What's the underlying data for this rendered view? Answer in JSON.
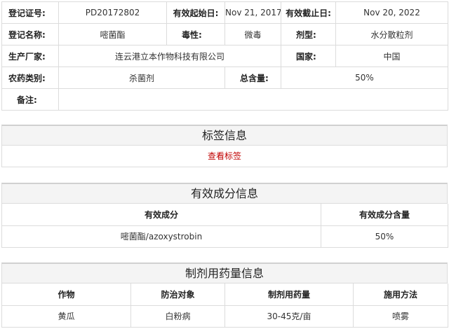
{
  "registration": {
    "reg_no_label": "登记证号:",
    "reg_no": "PD20172802",
    "valid_start_label": "有效起始日:",
    "valid_start": "Nov 21, 2017",
    "valid_end_label": "有效截止日:",
    "valid_end": "Nov 20, 2022",
    "name_label": "登记名称:",
    "name": "嘧菌酯",
    "toxicity_label": "毒性:",
    "toxicity": "微毒",
    "form_label": "剂型:",
    "form": "水分散粒剂",
    "manufacturer_label": "生产厂家:",
    "manufacturer": "连云港立本作物科技有限公司",
    "country_label": "国家:",
    "country": "中国",
    "category_label": "农药类别:",
    "category": "杀菌剂",
    "total_label": "总含量:",
    "total": "50%",
    "notes_label": "备注:",
    "notes": ""
  },
  "label_section": {
    "title": "标签信息",
    "link": "查看标签"
  },
  "ingredients_section": {
    "title": "有效成分信息",
    "headers": [
      "有效成分",
      "有效成分含量"
    ],
    "rows": [
      [
        "嘧菌酯/azoxystrobin",
        "50%"
      ]
    ]
  },
  "dosage_section": {
    "title": "制剂用药量信息",
    "headers": [
      "作物",
      "防治对象",
      "制剂用药量",
      "施用方法"
    ],
    "rows": [
      [
        "黄瓜",
        "白粉病",
        "30-45克/亩",
        "喷雾"
      ]
    ]
  }
}
